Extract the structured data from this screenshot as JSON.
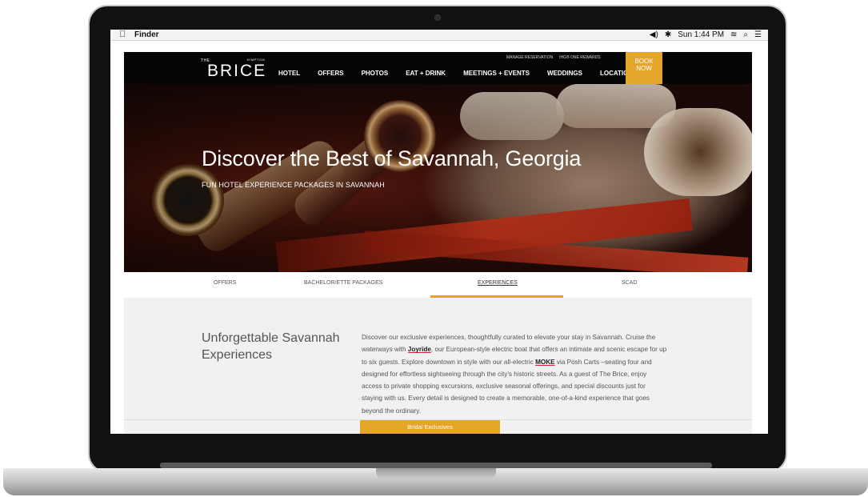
{
  "menubar": {
    "app_name": "Finder",
    "volume": "◀︎)",
    "bluetooth": "✱",
    "clock": "Sun 1:44 PM",
    "wifi": "≋",
    "search": "⌕",
    "list": "☰"
  },
  "nav": {
    "logo_the": "THE",
    "logo_kimpton": "KIMPTON",
    "logo_brice": "BRICE",
    "manage_reservation": "MANAGE RESERVATION",
    "ihg_rewards": "IHG® ONE REWARDS",
    "items": [
      "HOTEL",
      "OFFERS",
      "PHOTOS",
      "EAT + DRINK",
      "MEETINGS + EVENTS",
      "WEDDINGS",
      "LOCATION"
    ],
    "book_line1": "BOOK",
    "book_line2": "NOW"
  },
  "hero": {
    "title": "Discover the Best of Savannah, Georgia",
    "subtitle": "FUN HOTEL EXPERIENCE PACKAGES IN SAVANNAH"
  },
  "tabs": [
    {
      "label": "OFFERS",
      "active": false
    },
    {
      "label": "BACHELOR/ETTE PACKAGES",
      "active": false
    },
    {
      "label": "EXPERIENCES",
      "active": true
    },
    {
      "label": "SCAD",
      "active": false
    }
  ],
  "section": {
    "title": "Unforgettable Savannah Experiences",
    "body_1": "Discover our exclusive experiences, thoughtfully curated to elevate your stay in Savannah. Cruise the waterways with ",
    "link_joyride": "Joyride",
    "body_2": ", our European-style electric boat that offers an intimate and scenic escape for up to six guests. Explore downtown in style with our all-electric ",
    "link_moke": "MOKE",
    "body_3": " via Posh Carts –seating four and designed for effortless sightseeing through the city's historic streets. As a guest of The Brice, enjoy access to private shopping excursions, exclusive seasonal offerings, and special discounts just for staying with us. Every detail is designed to create a memorable, one-of-a-kind experience that goes beyond the ordinary.",
    "button": "Bridal Exclusives"
  },
  "colors": {
    "accent": "#e3a62a",
    "nav_bg": "#050505",
    "link_underline": "#dd2233"
  }
}
